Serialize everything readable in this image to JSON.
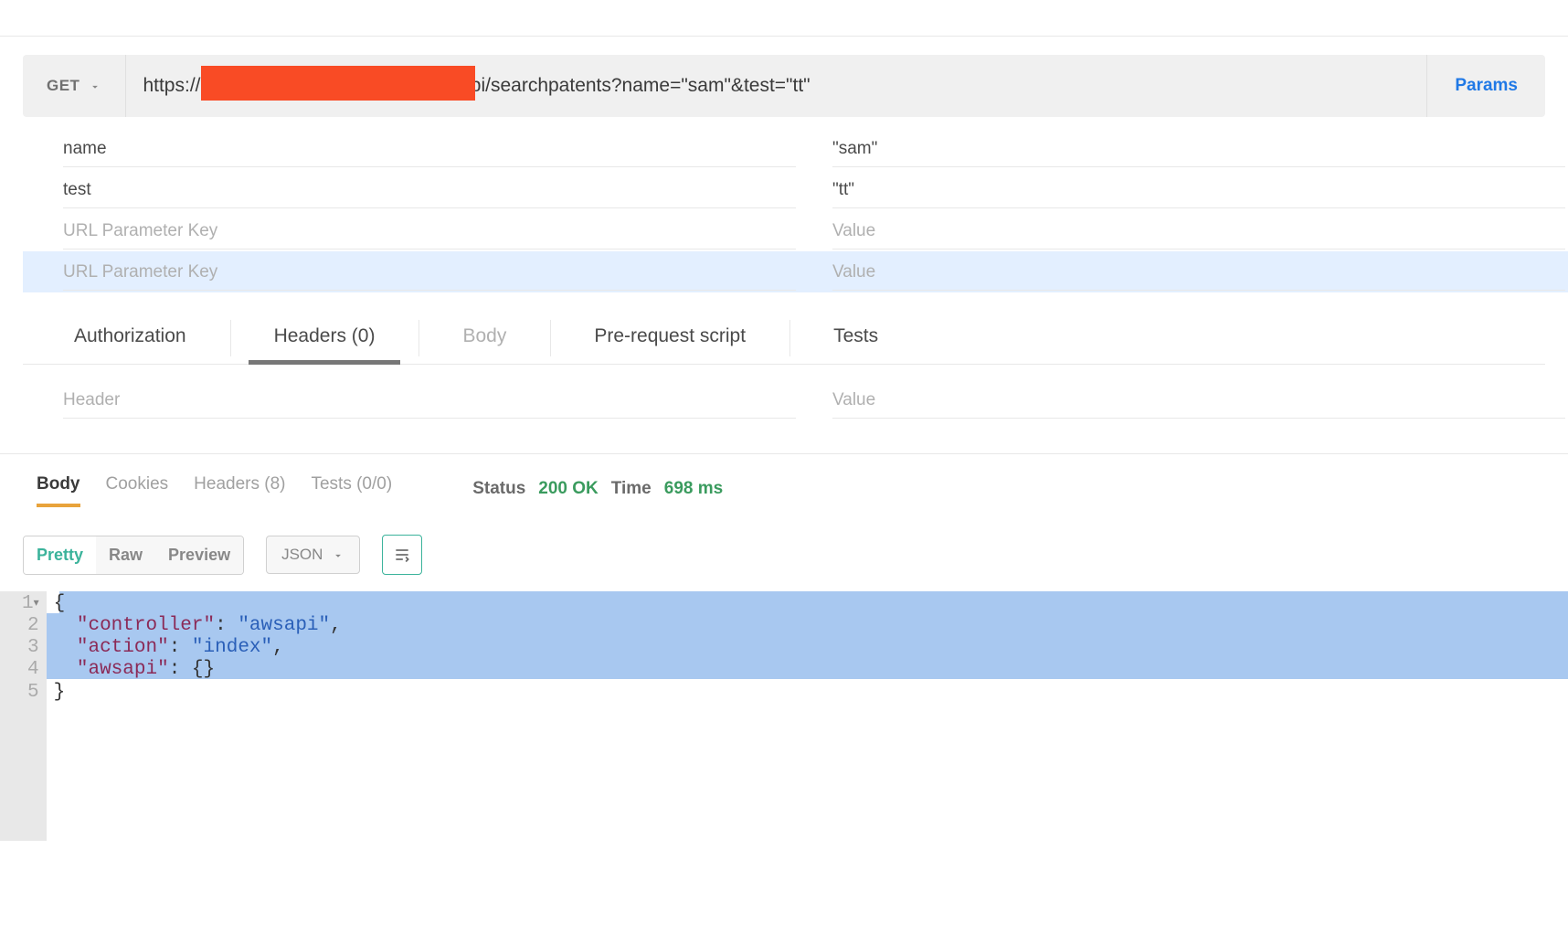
{
  "request": {
    "method": "GET",
    "url": "https://                                      st-1.amazonaws.com/conceptapi/searchpatents?name=\"sam\"&test=\"tt\"",
    "params_button": "Params",
    "params": [
      {
        "key": "name",
        "value": "\"sam\""
      },
      {
        "key": "test",
        "value": "\"tt\""
      }
    ],
    "param_key_placeholder": "URL Parameter Key",
    "param_value_placeholder": "Value",
    "tabs": {
      "authorization": "Authorization",
      "headers": "Headers (0)",
      "body": "Body",
      "prerequest": "Pre-request script",
      "tests": "Tests",
      "active": "headers"
    },
    "header_key_placeholder": "Header",
    "header_value_placeholder": "Value"
  },
  "response": {
    "tabs": {
      "body": "Body",
      "cookies": "Cookies",
      "headers": "Headers (8)",
      "tests": "Tests (0/0)",
      "active": "body"
    },
    "status_label": "Status",
    "status_value": "200 OK",
    "time_label": "Time",
    "time_value": "698 ms",
    "view_modes": {
      "pretty": "Pretty",
      "raw": "Raw",
      "preview": "Preview",
      "active": "pretty"
    },
    "format_select": "JSON",
    "code_lines": [
      "{",
      "  \"controller\": \"awsapi\",",
      "  \"action\": \"index\",",
      "  \"awsapi\": {}",
      "}"
    ]
  }
}
